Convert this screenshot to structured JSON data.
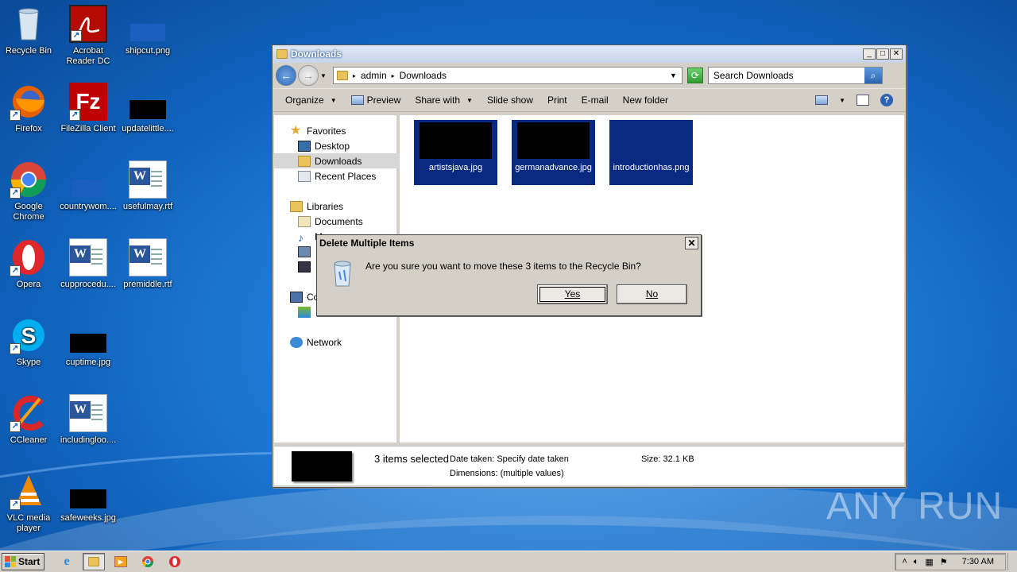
{
  "desktop": {
    "icons": [
      {
        "label": "Recycle Bin",
        "icon": "recycle-bin-icon"
      },
      {
        "label": "Acrobat Reader DC",
        "icon": "acrobat-icon"
      },
      {
        "label": "shipcut.png",
        "icon": "image-file-icon"
      },
      {
        "label": "Firefox",
        "icon": "firefox-icon"
      },
      {
        "label": "FileZilla Client",
        "icon": "filezilla-icon"
      },
      {
        "label": "updatelittle....",
        "icon": "image-file-icon"
      },
      {
        "label": "Google Chrome",
        "icon": "chrome-icon"
      },
      {
        "label": "countrywom....",
        "icon": "image-file-icon"
      },
      {
        "label": "usefulmay.rtf",
        "icon": "word-doc-icon"
      },
      {
        "label": "Opera",
        "icon": "opera-icon"
      },
      {
        "label": "cupprocedu....",
        "icon": "word-doc-icon"
      },
      {
        "label": "premiddle.rtf",
        "icon": "word-doc-icon"
      },
      {
        "label": "Skype",
        "icon": "skype-icon"
      },
      {
        "label": "cuptime.jpg",
        "icon": "image-file-icon"
      },
      {
        "label": "CCleaner",
        "icon": "ccleaner-icon"
      },
      {
        "label": "includingloo....",
        "icon": "word-doc-icon"
      },
      {
        "label": "VLC media player",
        "icon": "vlc-icon"
      },
      {
        "label": "safeweeks.jpg",
        "icon": "image-file-icon"
      }
    ]
  },
  "window": {
    "title": "Downloads",
    "address": {
      "crumb1": "admin",
      "crumb2": "Downloads"
    },
    "search_placeholder": "Search Downloads",
    "toolbar": {
      "organize": "Organize",
      "preview": "Preview",
      "share_with": "Share with",
      "slide_show": "Slide show",
      "print": "Print",
      "email": "E-mail",
      "new_folder": "New folder"
    },
    "nav": {
      "favorites": "Favorites",
      "desktop": "Desktop",
      "downloads": "Downloads",
      "recent_places": "Recent Places",
      "libraries": "Libraries",
      "documents": "Documents",
      "music_partial": "M",
      "computer_partial": "Co",
      "network": "Network"
    },
    "files": [
      {
        "name": "artistsjava.jpg"
      },
      {
        "name": "germanadvance.jpg"
      },
      {
        "name": "introductionhas.png"
      }
    ],
    "status": {
      "selected": "3 items selected",
      "date_taken": "Date taken: Specify date taken",
      "size": "Size: 32.1 KB",
      "dimensions": "Dimensions: (multiple values)"
    }
  },
  "dialog": {
    "title": "Delete Multiple Items",
    "message": "Are you sure you want to move these 3 items to the Recycle Bin?",
    "yes": "Yes",
    "no": "No"
  },
  "taskbar": {
    "start": "Start",
    "clock": "7:30 AM"
  },
  "watermark": "ANY RUN"
}
